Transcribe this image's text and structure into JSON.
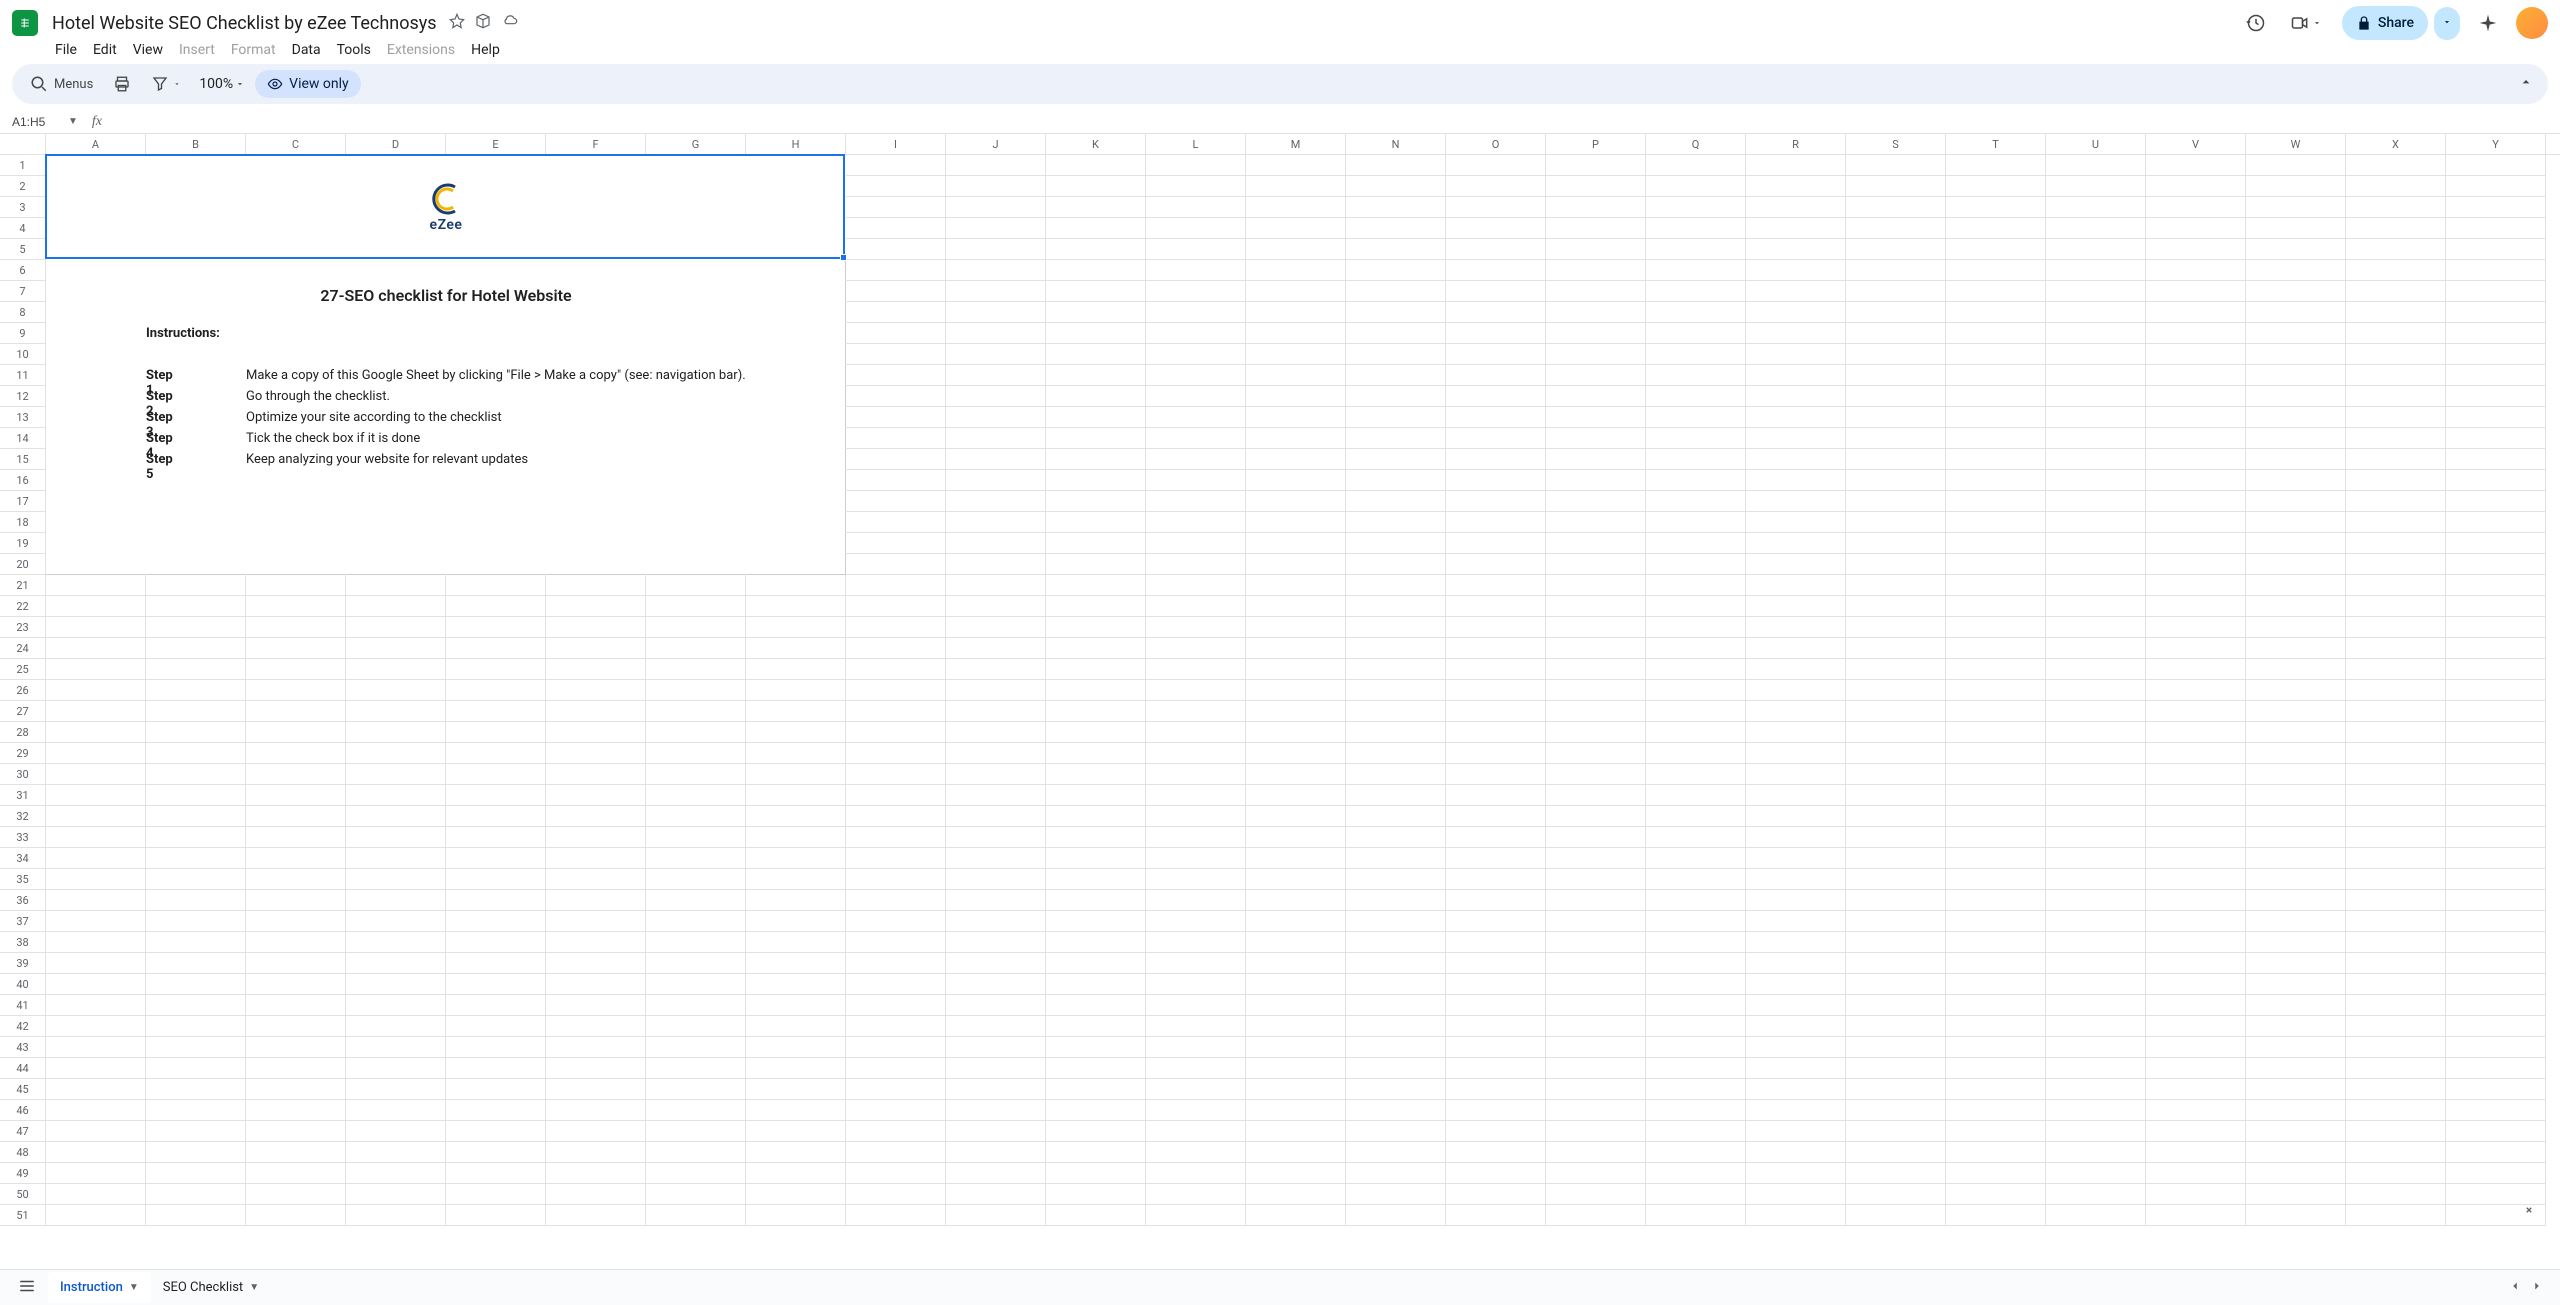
{
  "doc": {
    "title": "Hotel Website SEO Checklist by eZee Technosys"
  },
  "menubar": {
    "file": "File",
    "edit": "Edit",
    "view": "View",
    "insert": "Insert",
    "format": "Format",
    "data": "Data",
    "tools": "Tools",
    "extensions": "Extensions",
    "help": "Help"
  },
  "toolbar": {
    "menus_placeholder": "Menus",
    "zoom": "100%",
    "view_only": "View only"
  },
  "formula_bar": {
    "name_box": "A1:H5"
  },
  "header_right": {
    "share": "Share"
  },
  "columns": [
    "A",
    "B",
    "C",
    "D",
    "E",
    "F",
    "G",
    "H",
    "I",
    "J",
    "K",
    "L",
    "M",
    "N",
    "O",
    "P",
    "Q",
    "R",
    "S",
    "T",
    "U",
    "V",
    "W",
    "X",
    "Y"
  ],
  "col_widths": {
    "A": 100,
    "B": 100,
    "C": 100,
    "D": 100,
    "E": 100,
    "F": 100,
    "G": 100,
    "H": 100,
    "default": 100
  },
  "row_count": 51,
  "content": {
    "logo_text": "eZee",
    "heading": "27-SEO checklist for Hotel Website",
    "instructions_label": "Instructions:",
    "steps": [
      {
        "label": "Step 1",
        "text": "Make a copy of this Google Sheet by clicking \"File > Make a copy\" (see: navigation bar)."
      },
      {
        "label": "Step 2",
        "text": "Go through the checklist."
      },
      {
        "label": "Step 3",
        "text": "Optimize your site according to the checklist"
      },
      {
        "label": "Step 4",
        "text": "Tick the check box if it is done"
      },
      {
        "label": "Step 5",
        "text": "Keep analyzing your website for relevant updates"
      }
    ]
  },
  "sheet_tabs": [
    {
      "name": "Instruction",
      "active": true
    },
    {
      "name": "SEO Checklist",
      "active": false
    }
  ],
  "selection": {
    "range": "A1:H5"
  }
}
